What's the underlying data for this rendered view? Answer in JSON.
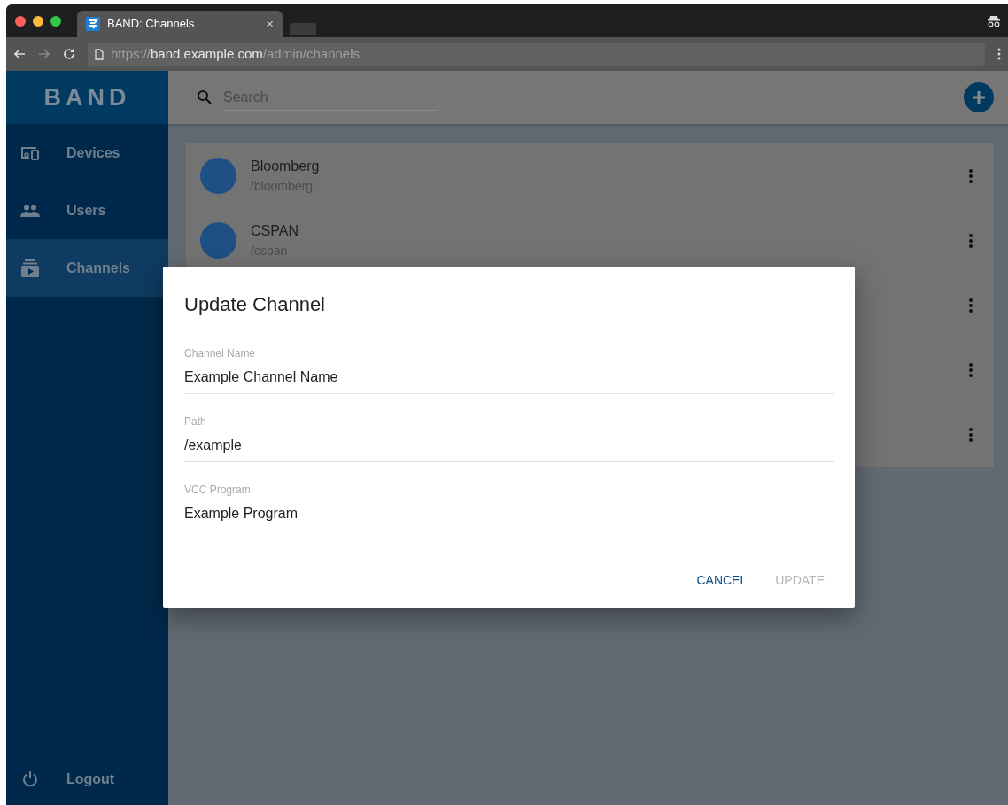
{
  "browser": {
    "tab_title": "BAND: Channels",
    "tab_close": "×",
    "url_scheme": "https://",
    "url_host": "band.example.com",
    "url_path": "/admin/channels"
  },
  "logo": "BAND",
  "sidebar": {
    "items": [
      {
        "label": "Devices",
        "selected": false
      },
      {
        "label": "Users",
        "selected": false
      },
      {
        "label": "Channels",
        "selected": true
      }
    ],
    "footer": {
      "label": "Logout"
    }
  },
  "search": {
    "placeholder": "Search"
  },
  "channels": [
    {
      "kind": "full",
      "name": "Bloomberg",
      "path": "/bloomberg"
    },
    {
      "kind": "full",
      "name": "CSPAN",
      "path": "/cspan"
    },
    {
      "kind": "covered"
    },
    {
      "kind": "covered"
    },
    {
      "kind": "covered"
    }
  ],
  "dialog": {
    "title": "Update Channel",
    "fields": [
      {
        "label": "Channel Name",
        "value": "Example Channel Name"
      },
      {
        "label": "Path",
        "value": "/example"
      },
      {
        "label": "VCC Program",
        "value": "Example Program"
      }
    ],
    "buttons": [
      {
        "label": "CANCEL",
        "disabled": false
      },
      {
        "label": "UPDATE",
        "disabled": true
      }
    ]
  }
}
